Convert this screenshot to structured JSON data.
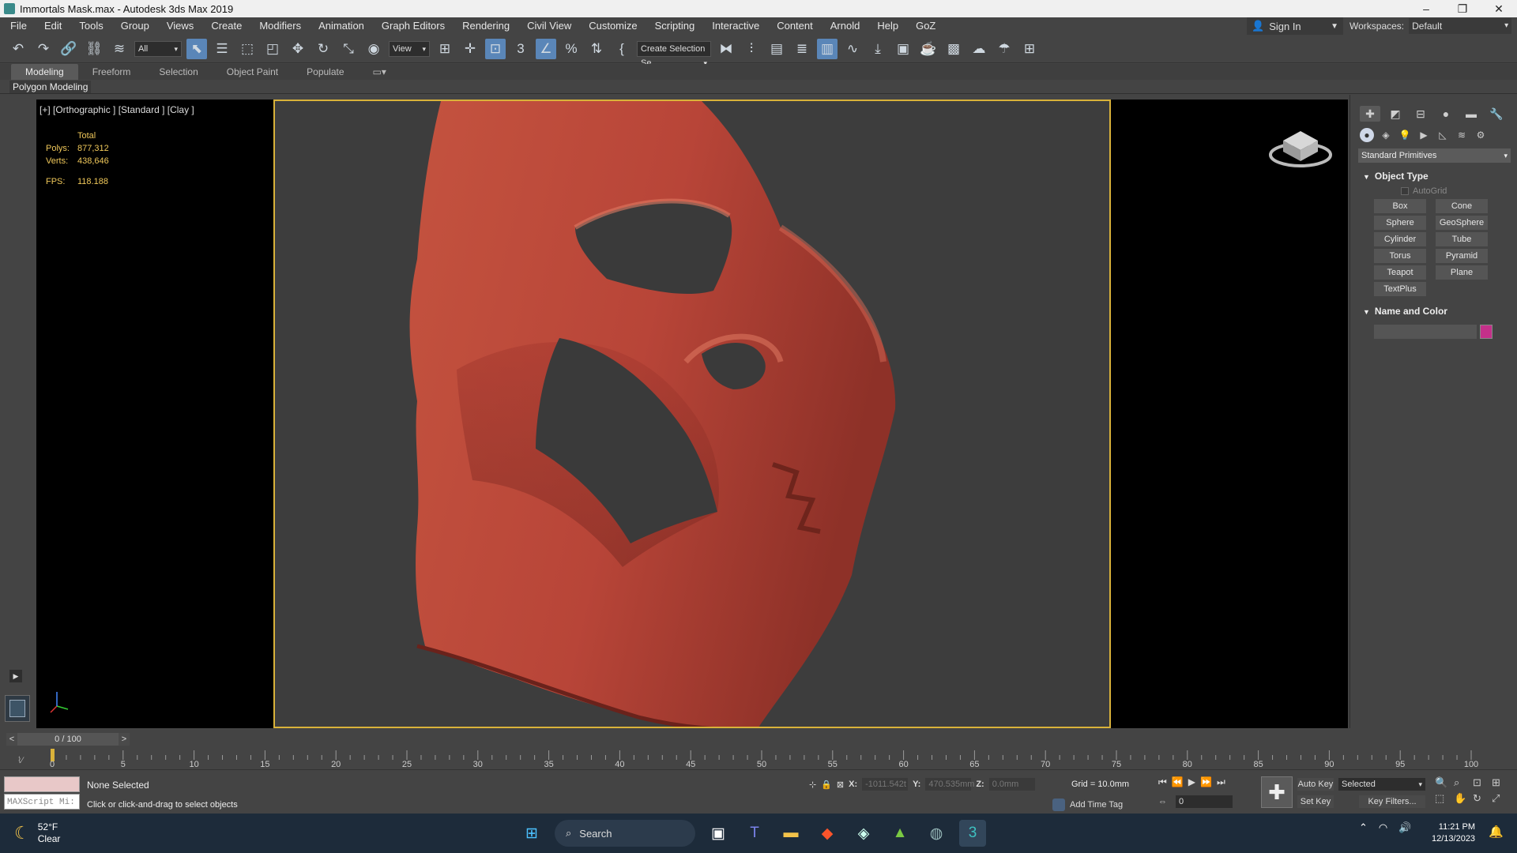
{
  "window": {
    "title": "Immortals Mask.max - Autodesk 3ds Max 2019",
    "controls": [
      "–",
      "❐",
      "✕"
    ]
  },
  "menu": [
    "File",
    "Edit",
    "Tools",
    "Group",
    "Views",
    "Create",
    "Modifiers",
    "Animation",
    "Graph Editors",
    "Rendering",
    "Civil View",
    "Customize",
    "Scripting",
    "Interactive",
    "Content",
    "Arnold",
    "Help",
    "GoZ"
  ],
  "signin": {
    "label": "Sign In"
  },
  "workspaces": {
    "label": "Workspaces:",
    "value": "Default"
  },
  "toolbar": {
    "filter": "All",
    "refcoord": "View",
    "selection_set": "Create Selection Se"
  },
  "ribbon": {
    "tabs": [
      "Modeling",
      "Freeform",
      "Selection",
      "Object Paint",
      "Populate"
    ],
    "active": "Modeling",
    "panel": "Polygon Modeling"
  },
  "viewport": {
    "label": "[+] [Orthographic ] [Standard ] [Clay ]",
    "stats": {
      "header": "Total",
      "polys_label": "Polys:",
      "polys": "877,312",
      "verts_label": "Verts:",
      "verts": "438,646",
      "fps_label": "FPS:",
      "fps": "118.188"
    },
    "accent_safe_frame": "#d9b23a",
    "model_color": "#b8473a"
  },
  "command_panel": {
    "category": "Standard Primitives",
    "object_type": {
      "title": "Object Type",
      "autogrid": "AutoGrid",
      "buttons": [
        "Box",
        "Cone",
        "Sphere",
        "GeoSphere",
        "Cylinder",
        "Tube",
        "Torus",
        "Pyramid",
        "Teapot",
        "Plane",
        "TextPlus"
      ]
    },
    "name_color": {
      "title": "Name and Color",
      "name": "",
      "color": "#c4308a"
    }
  },
  "timeline": {
    "slider": "0 / 100",
    "prev": "<",
    "next": ">",
    "ticks": [
      "0",
      "5",
      "10",
      "15",
      "20",
      "25",
      "30",
      "35",
      "40",
      "45",
      "50",
      "55",
      "60",
      "65",
      "70",
      "75",
      "80",
      "85",
      "90",
      "95",
      "100"
    ]
  },
  "status": {
    "maxscript": "MAXScript Mi:",
    "selection": "None Selected",
    "prompt": "Click or click-and-drag to select objects",
    "x_label": "X:",
    "x": "-1011.542t",
    "y_label": "Y:",
    "y": "470.535mm",
    "z_label": "Z:",
    "z": "0.0mm",
    "grid": "Grid = 10.0mm",
    "add_time_tag": "Add Time Tag",
    "frame": "0",
    "auto_key": "Auto Key",
    "set_key": "Set Key",
    "key_mode": "Selected",
    "key_filters": "Key Filters..."
  },
  "taskbar": {
    "temperature": "52°F",
    "condition": "Clear",
    "search": "Search",
    "time": "11:21 PM",
    "date": "12/13/2023"
  }
}
